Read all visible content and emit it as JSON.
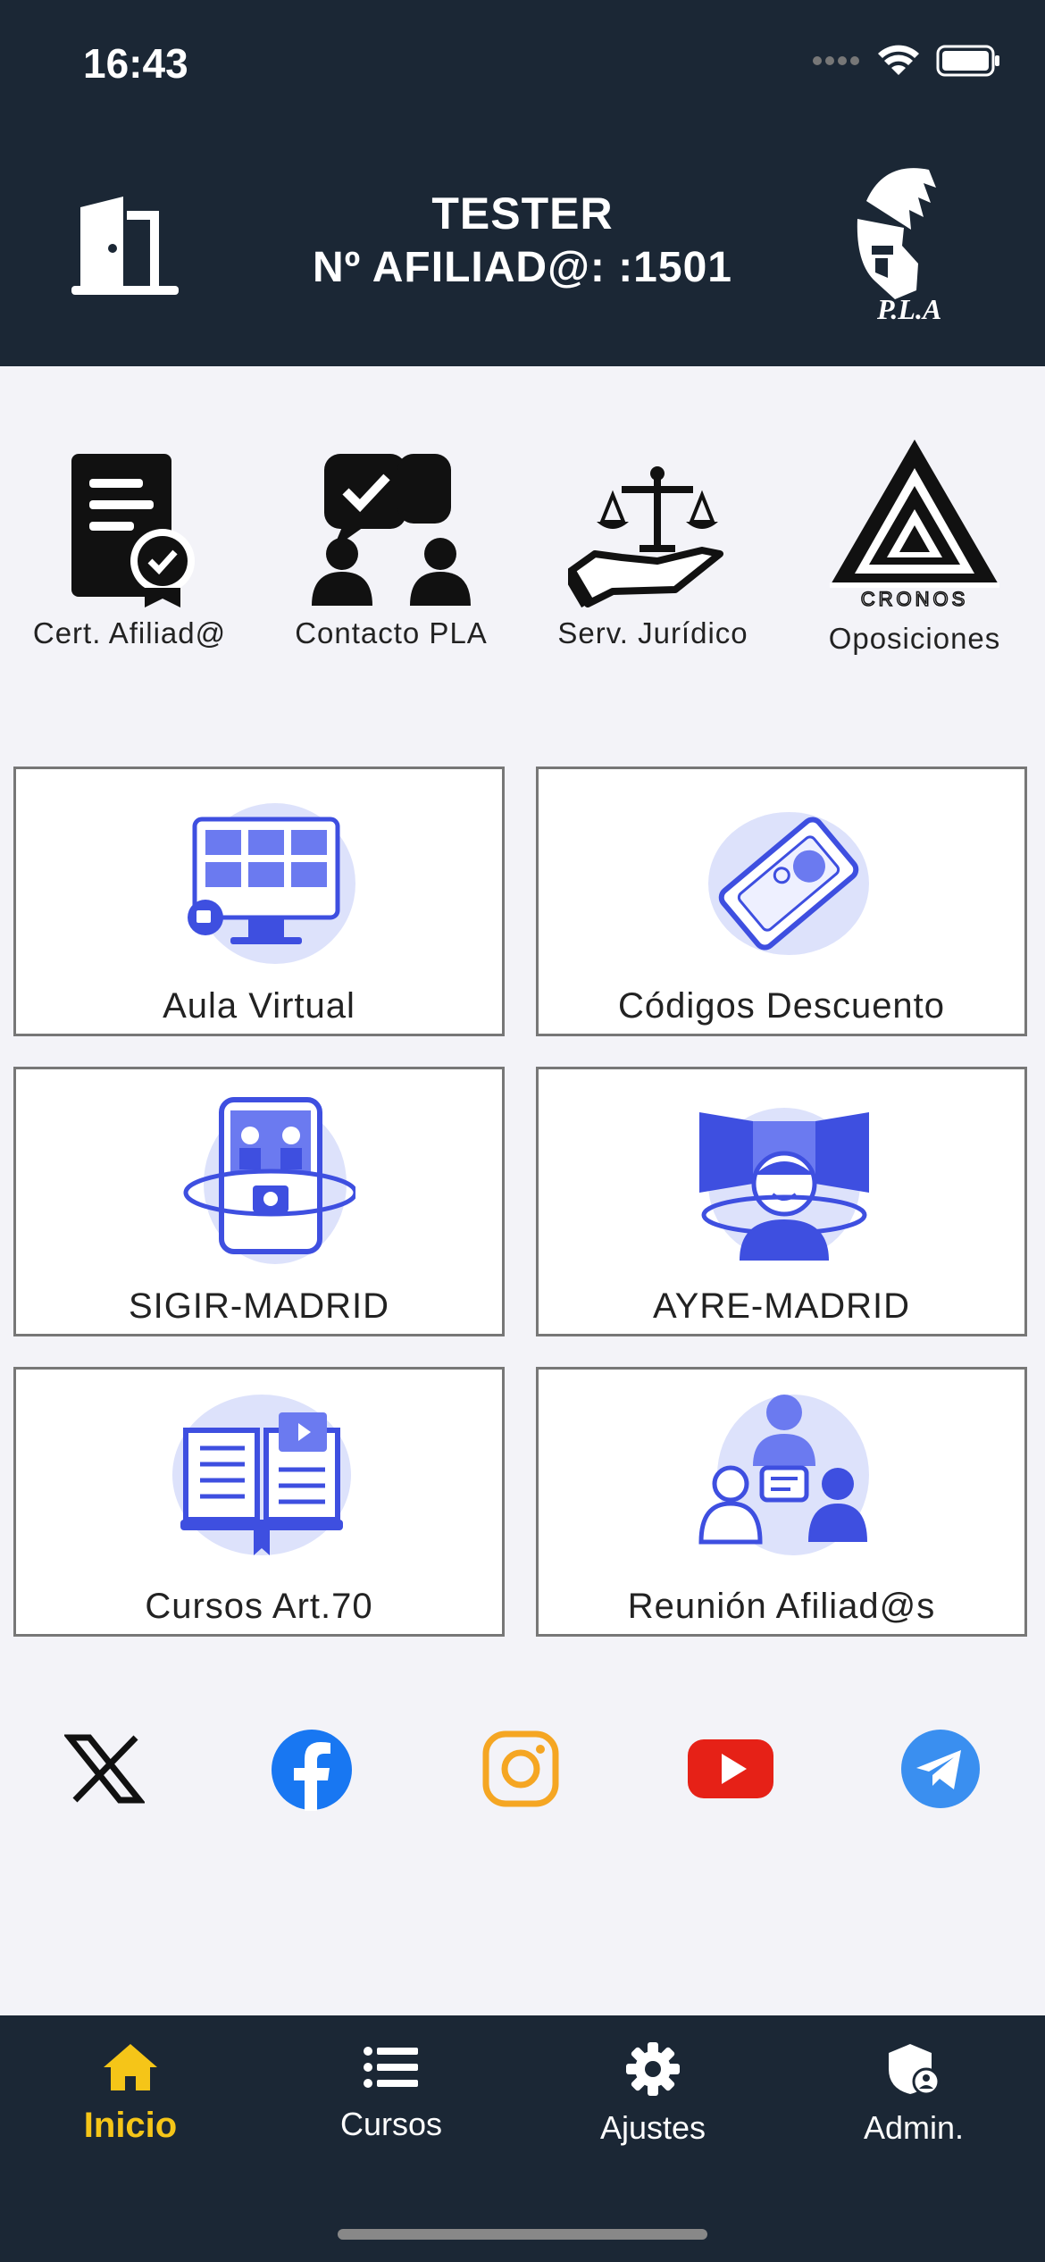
{
  "status": {
    "time": "16:43"
  },
  "header": {
    "name": "TESTER",
    "member_label": "Nº AFILIAD@: :1501"
  },
  "quick_actions": [
    {
      "label": "Cert. Afiliad@",
      "icon": "certificate-icon"
    },
    {
      "label": "Contacto PLA",
      "icon": "chat-people-icon"
    },
    {
      "label": "Serv. Jurídico",
      "icon": "legal-scale-icon"
    },
    {
      "label": "Oposiciones",
      "icon": "cronos-logo"
    }
  ],
  "logo_text": {
    "pla": "P.L.A",
    "cronos": "CRONOS"
  },
  "cards": [
    {
      "label": "Aula Virtual"
    },
    {
      "label": "Códigos Descuento"
    },
    {
      "label": "SIGIR-MADRID"
    },
    {
      "label": "AYRE-MADRID"
    },
    {
      "label": "Cursos Art.70"
    },
    {
      "label": "Reunión Afiliad@s"
    }
  ],
  "social": [
    "x-icon",
    "facebook-icon",
    "instagram-icon",
    "youtube-icon",
    "telegram-icon"
  ],
  "tabs": [
    {
      "label": "Inicio",
      "active": true
    },
    {
      "label": "Cursos",
      "active": false
    },
    {
      "label": "Ajustes",
      "active": false
    },
    {
      "label": "Admin.",
      "active": false
    }
  ],
  "colors": {
    "header_bg": "#1b2735",
    "accent": "#f5c518",
    "illustration": "#3e4fe0"
  }
}
